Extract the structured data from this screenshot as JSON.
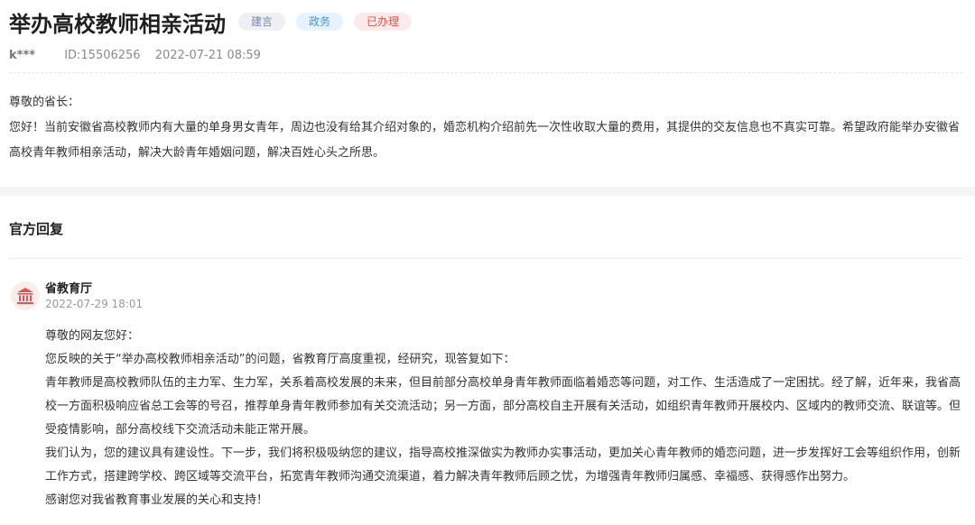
{
  "header": {
    "title": "举办高校教师相亲活动",
    "tags": [
      "建言",
      "政务",
      "已办理"
    ]
  },
  "meta": {
    "user": "k***",
    "id": "ID:15506256",
    "datetime": "2022-07-21 08:59"
  },
  "message": {
    "greeting": "尊敬的省长：",
    "body": "您好！当前安徽省高校教师内有大量的单身男女青年，周边也没有给其介绍对象的，婚恋机构介绍前先一次性收取大量的费用，其提供的交友信息也不真实可靠。希望政府能举办安徽省高校青年教师相亲活动，解决大龄青年婚姻问题，解决百姓心头之所思。"
  },
  "reply_section": {
    "title": "官方回复",
    "org": "省教育厅",
    "datetime": "2022-07-29 18:01",
    "avatar_icon": "government-building-icon",
    "paragraphs": [
      "尊敬的网友您好：",
      "您反映的关于“举办高校教师相亲活动”的问题，省教育厅高度重视，经研究，现答复如下：",
      "青年教师是高校教师队伍的主力军、生力军，关系着高校发展的未来，但目前部分高校单身青年教师面临着婚恋等问题，对工作、生活造成了一定困扰。经了解，近年来，我省高校一方面积极响应省总工会等的号召，推荐单身青年教师参加有关交流活动；另一方面，部分高校自主开展有关活动，如组织青年教师开展校内、区域内的教师交流、联谊等。但受疫情影响，部分高校线下交流活动未能正常开展。",
      "我们认为，您的建议具有建设性。下一步，我们将积极吸纳您的建议，指导高校推深做实为教师办实事活动，更加关心青年教师的婚恋问题，进一步发挥好工会等组织作用，创新工作方式，搭建跨学校、跨区域等交流平台，拓宽青年教师沟通交流渠道，着力解决青年教师后顾之忧，为增强青年教师归属感、幸福感、获得感作出努力。",
      "感谢您对我省教育事业发展的关心和支持！"
    ]
  },
  "colors": {
    "accent_red": "#e0554f",
    "accent_blue": "#4a90e2",
    "tag_gray": "#7b86a8"
  }
}
